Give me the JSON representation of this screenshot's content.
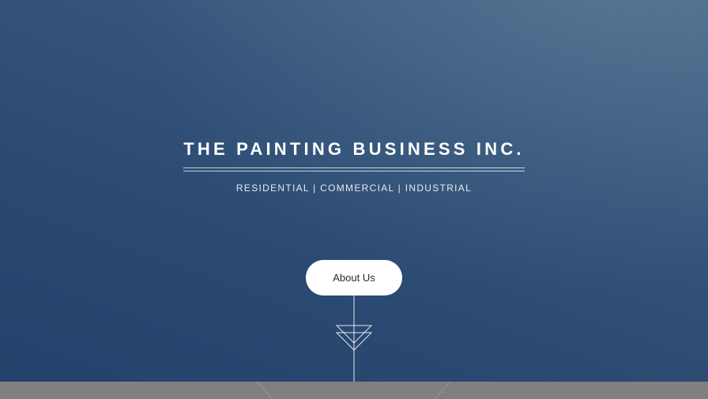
{
  "hero": {
    "title": "THE PAINTING BUSINESS INC.",
    "subtitle": "RESIDENTIAL | COMMERCIAL | INDUSTRIAL",
    "about_button_label": "About Us",
    "scroll_indicator_icon": "down-arrow-triangles-icon"
  },
  "colors": {
    "hero_background_top": "#4a6889",
    "hero_background_bottom": "#23436c",
    "button_background": "#ffffff",
    "footer_band": "#808080"
  }
}
